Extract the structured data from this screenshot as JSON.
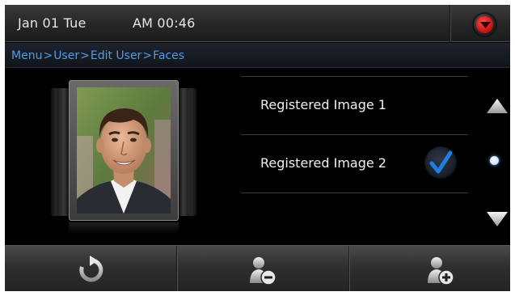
{
  "status_bar": {
    "date": "Jan 01 Tue",
    "time": "AM 00:46",
    "dropdown_icon": "chevron-down-icon",
    "accent_color": "#e01818"
  },
  "breadcrumb": {
    "items": [
      "Menu",
      "User",
      "Edit User",
      "Faces"
    ],
    "separator": ">",
    "color": "#4f9de8"
  },
  "face_preview": {
    "icon": "face-photo"
  },
  "images_list": {
    "items": [
      {
        "label": "Registered Image 1",
        "selected": false
      },
      {
        "label": "Registered Image 2",
        "selected": true
      }
    ],
    "check_color": "#1f7fe0"
  },
  "scroll": {
    "up_icon": "triangle-up-icon",
    "down_icon": "triangle-down-icon",
    "position_icon": "dot-indicator"
  },
  "toolbar": {
    "buttons": [
      {
        "icon": "refresh-icon",
        "action": "recapture"
      },
      {
        "icon": "user-remove-icon",
        "action": "delete"
      },
      {
        "icon": "user-add-icon",
        "action": "add"
      }
    ]
  }
}
